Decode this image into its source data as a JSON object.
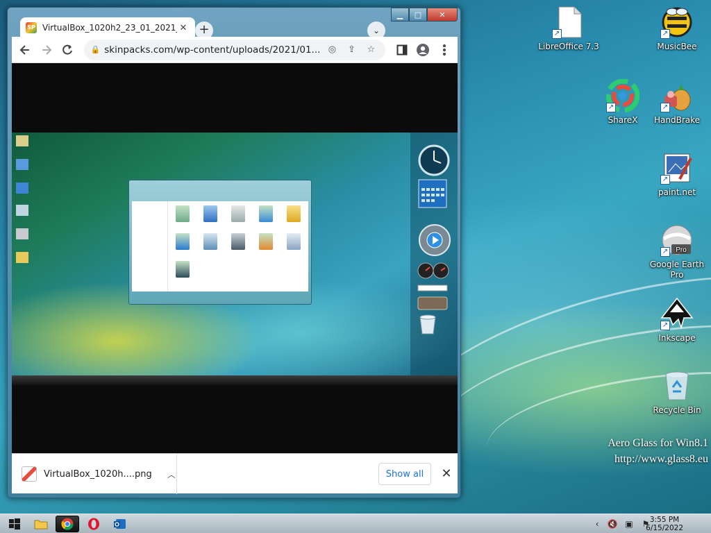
{
  "browser": {
    "tab": {
      "title": "VirtualBox_1020h2_23_01_2021_1",
      "favicon_text": "SP"
    },
    "url": "skinpacks.com/wp-content/uploads/2021/01...",
    "downloads": {
      "file_name": "VirtualBox_1020h....png",
      "show_all": "Show all"
    }
  },
  "desktop": {
    "icons": [
      {
        "id": "libreoffice",
        "label": "LibreOffice 7.3"
      },
      {
        "id": "musicbee",
        "label": "MusicBee"
      },
      {
        "id": "sharex",
        "label": "ShareX"
      },
      {
        "id": "handbrake",
        "label": "HandBrake"
      },
      {
        "id": "paintnet",
        "label": "paint.net"
      },
      {
        "id": "googleearth",
        "label": "Google Earth Pro"
      },
      {
        "id": "inkscape",
        "label": "Inkscape"
      },
      {
        "id": "recyclebin",
        "label": "Recycle Bin"
      }
    ],
    "watermark": {
      "line1": "Aero Glass for Win8.1",
      "line2": "http://www.glass8.eu"
    }
  },
  "taskbar": {
    "time": "3:55 PM",
    "date": "6/15/2022"
  },
  "colors": {
    "accent": "#1a73e8",
    "close_red": "#c0392b",
    "taskbar": "#b9c4cc"
  }
}
